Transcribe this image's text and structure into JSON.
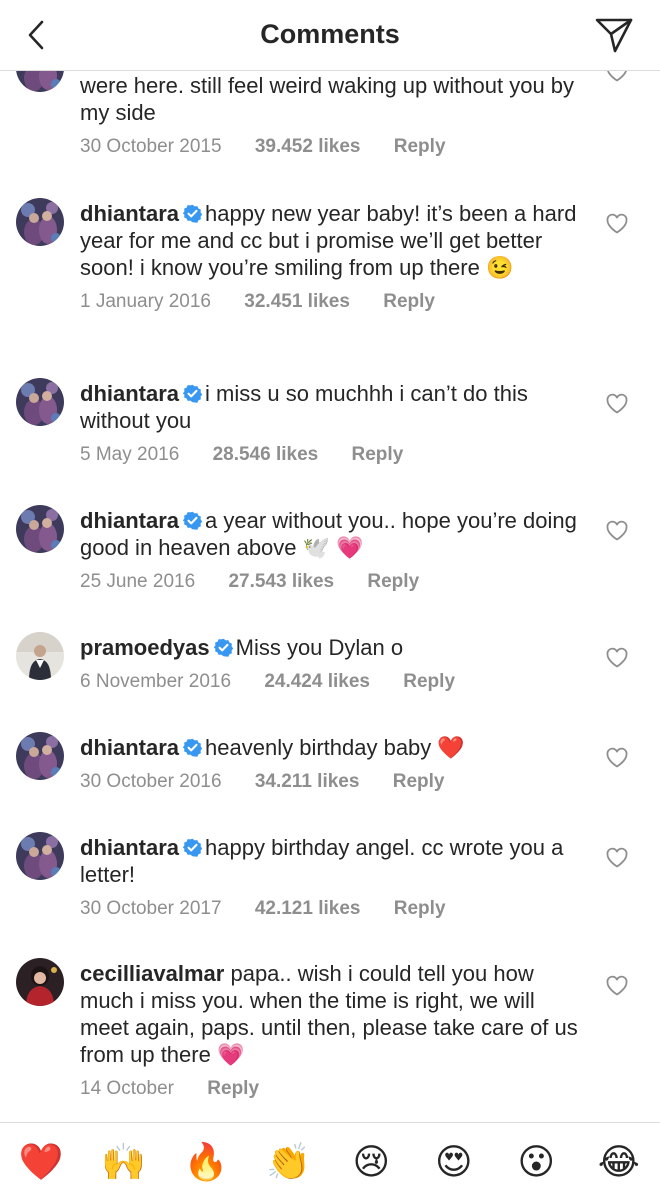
{
  "header": {
    "title": "Comments",
    "back_icon": "chevron-left-icon",
    "send_icon": "paper-plane-icon"
  },
  "comments": [
    {
      "username": "",
      "verified": false,
      "text": "were here. still feel weird waking up without you by my side",
      "date": "30 October 2015",
      "likes": "39.452 likes",
      "reply": "Reply"
    },
    {
      "username": "dhiantara",
      "verified": true,
      "text": "happy new year baby! it’s been a hard year for me and cc but i promise we’ll get better soon! i know you’re smiling from up there 😉",
      "date": "1 January 2016",
      "likes": "32.451 likes",
      "reply": "Reply"
    },
    {
      "username": "dhiantara",
      "verified": true,
      "text": "i miss u so muchhh i can’t do this without you",
      "date": "5 May 2016",
      "likes": "28.546 likes",
      "reply": "Reply"
    },
    {
      "username": "dhiantara",
      "verified": true,
      "text": "a year without you.. hope you’re doing good in heaven above 🕊️ 💗",
      "date": "25 June 2016",
      "likes": "27.543 likes",
      "reply": "Reply"
    },
    {
      "username": "pramoedyas",
      "verified": true,
      "text": "Miss you Dylan o",
      "date": "6 November 2016",
      "likes": "24.424 likes",
      "reply": "Reply"
    },
    {
      "username": "dhiantara",
      "verified": true,
      "text": "heavenly birthday baby ❤️",
      "date": "30 October 2016",
      "likes": "34.211 likes",
      "reply": "Reply"
    },
    {
      "username": "dhiantara",
      "verified": true,
      "text": "happy birthday angel. cc wrote you a letter!",
      "date": "30 October 2017",
      "likes": "42.121 likes",
      "reply": "Reply"
    },
    {
      "username": "cecilliavalmar",
      "verified": false,
      "text": "papa.. wish i could tell you how much i miss you. when the time is right, we will meet again, paps. until then, please take care of us from up there 💗",
      "date": "14 October",
      "likes": "",
      "reply": "Reply"
    }
  ],
  "emoji_bar": [
    "❤️",
    "🙌",
    "🔥",
    "👏",
    "😢",
    "😍",
    "😮",
    "😂"
  ],
  "colors": {
    "text": "#262626",
    "meta": "#8e8e8e",
    "verified": "#3897f0",
    "divider": "#dbdbdb"
  }
}
